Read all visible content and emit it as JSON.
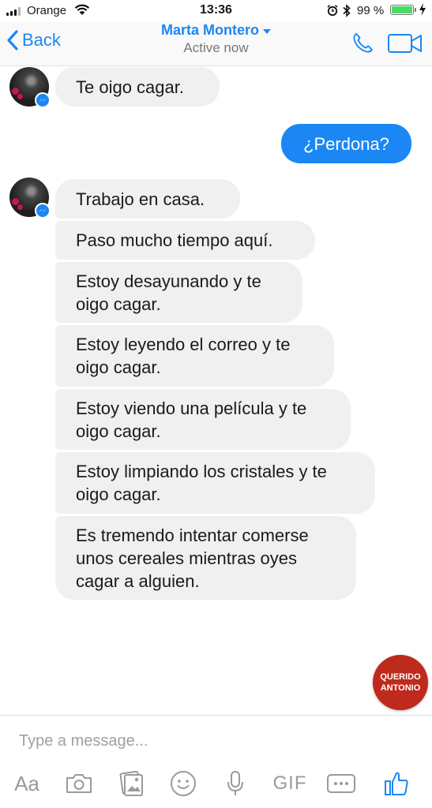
{
  "status_bar": {
    "carrier": "Orange",
    "time": "13:36",
    "battery_percent": "99 %",
    "battery_level": 0.99
  },
  "header": {
    "back_label": "Back",
    "contact_name": "Marta Montero",
    "contact_status": "Active now"
  },
  "messages": [
    {
      "direction": "incoming",
      "text": "Te oigo cagar."
    },
    {
      "direction": "outgoing",
      "text": "¿Perdona?"
    },
    {
      "direction": "incoming",
      "text": "Trabajo en casa."
    },
    {
      "direction": "incoming",
      "text": "Paso mucho tiempo aquí."
    },
    {
      "direction": "incoming",
      "text": "Estoy desayunando y te\noigo cagar."
    },
    {
      "direction": "incoming",
      "text": "Estoy leyendo el correo y te\noigo cagar."
    },
    {
      "direction": "incoming",
      "text": "Estoy viendo una película y te\noigo cagar."
    },
    {
      "direction": "incoming",
      "text": "Estoy limpiando los cristales y te\noigo cagar."
    },
    {
      "direction": "incoming",
      "text": "Es tremendo intentar comerse\nunos cereales mientras oyes\ncagar a alguien."
    }
  ],
  "watermark": {
    "line1": "QUERIDO",
    "line2": "ANTONIO"
  },
  "composer": {
    "placeholder": "Type a message...",
    "aa_label": "Aa",
    "gif_label": "GIF"
  },
  "icons": {
    "signal": "signal-icon",
    "wifi": "wifi-icon",
    "alarm": "alarm-icon",
    "bluetooth": "bluetooth-icon",
    "battery": "battery-icon",
    "charging": "charging-icon",
    "back": "chevron-left-icon",
    "dropdown": "caret-down-icon",
    "call": "phone-icon",
    "video": "video-camera-icon",
    "camera": "camera-icon",
    "gallery": "gallery-icon",
    "emoji": "emoji-icon",
    "microphone": "microphone-icon",
    "more": "more-icon",
    "like": "thumbs-up-icon"
  },
  "colors": {
    "accent": "#1b87f5",
    "incoming_bubble": "#f0f0f0",
    "watermark": "#be2a1c",
    "battery": "#4cd964"
  }
}
